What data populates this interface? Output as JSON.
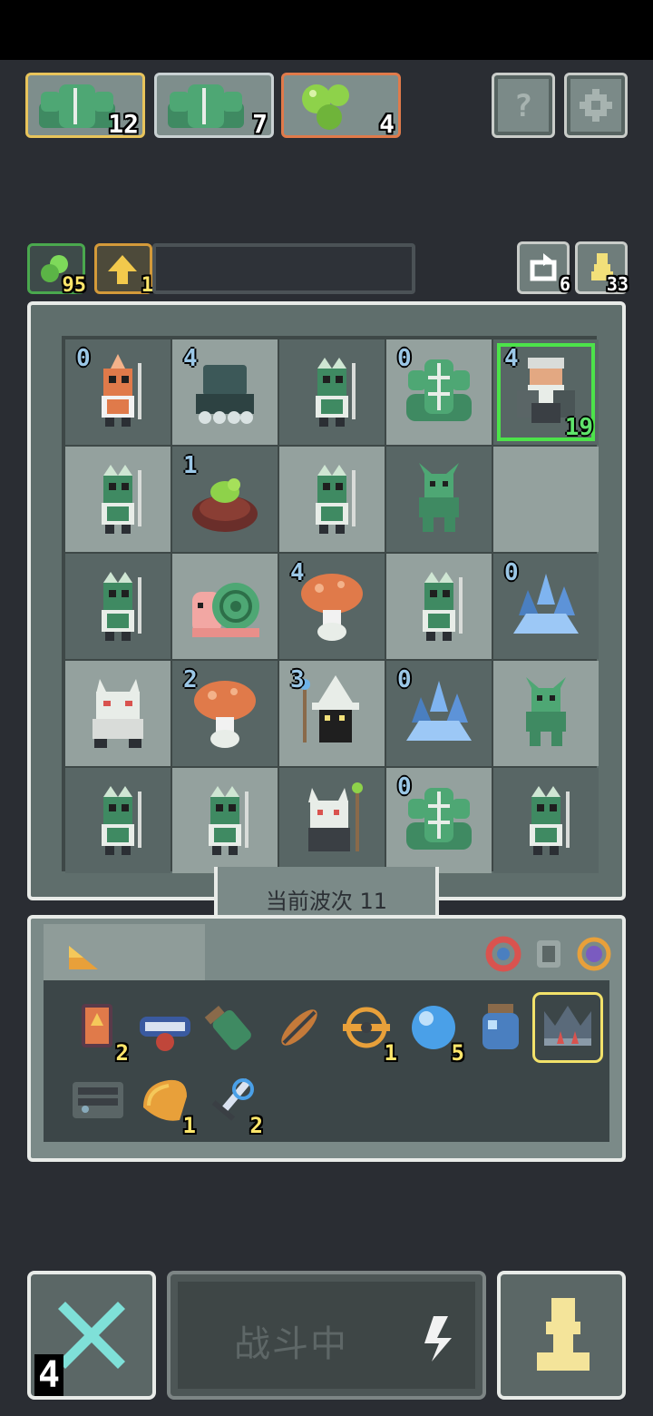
{
  "factions": [
    {
      "icon": "cactus-icon",
      "count": "12",
      "border": "#e8c45b"
    },
    {
      "icon": "cactus-icon",
      "count": "7",
      "border": "#c9d1d3"
    },
    {
      "icon": "slime-icon",
      "count": "4",
      "border": "#e07a4a"
    }
  ],
  "system": {
    "help_label": "?",
    "settings_icon": "gear-icon"
  },
  "resources": {
    "gold": {
      "icon": "gem-icon",
      "value": "95"
    },
    "upgrade": {
      "icon": "up-arrow-icon",
      "value": "1"
    },
    "refresh": {
      "icon": "refresh-icon",
      "value": "6"
    },
    "pieces": {
      "icon": "pawn-icon",
      "value": "33"
    }
  },
  "board": {
    "cells": [
      {
        "level": "0",
        "unit": "fire-goblin",
        "tag": ""
      },
      {
        "level": "4",
        "unit": "stone-tower",
        "tag": ""
      },
      {
        "level": "",
        "unit": "goblin-warrior",
        "tag": ""
      },
      {
        "level": "0",
        "unit": "cactus",
        "tag": ""
      },
      {
        "level": "4",
        "unit": "dwarf-boss",
        "tag": "19"
      },
      {
        "level": "",
        "unit": "goblin-warrior",
        "tag": ""
      },
      {
        "level": "1",
        "unit": "mud-slime",
        "tag": ""
      },
      {
        "level": "",
        "unit": "goblin-warrior",
        "tag": ""
      },
      {
        "level": "",
        "unit": "green-imp",
        "tag": ""
      },
      {
        "level": "",
        "unit": "empty",
        "tag": ""
      },
      {
        "level": "",
        "unit": "goblin-warrior",
        "tag": ""
      },
      {
        "level": "",
        "unit": "snail",
        "tag": ""
      },
      {
        "level": "4",
        "unit": "mushroom",
        "tag": ""
      },
      {
        "level": "",
        "unit": "goblin-warrior",
        "tag": ""
      },
      {
        "level": "0",
        "unit": "ice-crystal",
        "tag": ""
      },
      {
        "level": "",
        "unit": "white-wolf",
        "tag": ""
      },
      {
        "level": "2",
        "unit": "mushroom",
        "tag": ""
      },
      {
        "level": "3",
        "unit": "white-wizard",
        "tag": ""
      },
      {
        "level": "0",
        "unit": "ice-crystal",
        "tag": ""
      },
      {
        "level": "",
        "unit": "green-imp",
        "tag": ""
      },
      {
        "level": "",
        "unit": "goblin-warrior",
        "tag": ""
      },
      {
        "level": "",
        "unit": "goblin-warrior",
        "tag": ""
      },
      {
        "level": "",
        "unit": "wolf-shaman",
        "tag": ""
      },
      {
        "level": "0",
        "unit": "cactus",
        "tag": ""
      },
      {
        "level": "",
        "unit": "goblin-warrior",
        "tag": ""
      }
    ],
    "wave_label": "当前波次 11"
  },
  "inventory": {
    "tab_icon": "cheese-icon",
    "filters": [
      "red-ring-icon",
      "gray-armor-icon",
      "purple-ring-icon"
    ],
    "items": [
      {
        "icon": "fire-card-icon",
        "count": "2"
      },
      {
        "icon": "cart-icon",
        "count": ""
      },
      {
        "icon": "potion-bottle-icon",
        "count": ""
      },
      {
        "icon": "feather-icon",
        "count": ""
      },
      {
        "icon": "orbit-ring-icon",
        "count": "1"
      },
      {
        "icon": "blue-orb-icon",
        "count": "5"
      },
      {
        "icon": "blue-jar-icon",
        "count": ""
      },
      {
        "icon": "crown-icon",
        "count": "",
        "selected": true
      },
      {
        "icon": "radio-box-icon",
        "count": ""
      },
      {
        "icon": "horn-icon",
        "count": "1"
      },
      {
        "icon": "ice-sword-icon",
        "count": "2"
      }
    ]
  },
  "actions": {
    "close_count": "4",
    "battle_label": "战斗中",
    "battle_icon": "zigzag-icon",
    "pawn_icon": "pawn-icon"
  }
}
